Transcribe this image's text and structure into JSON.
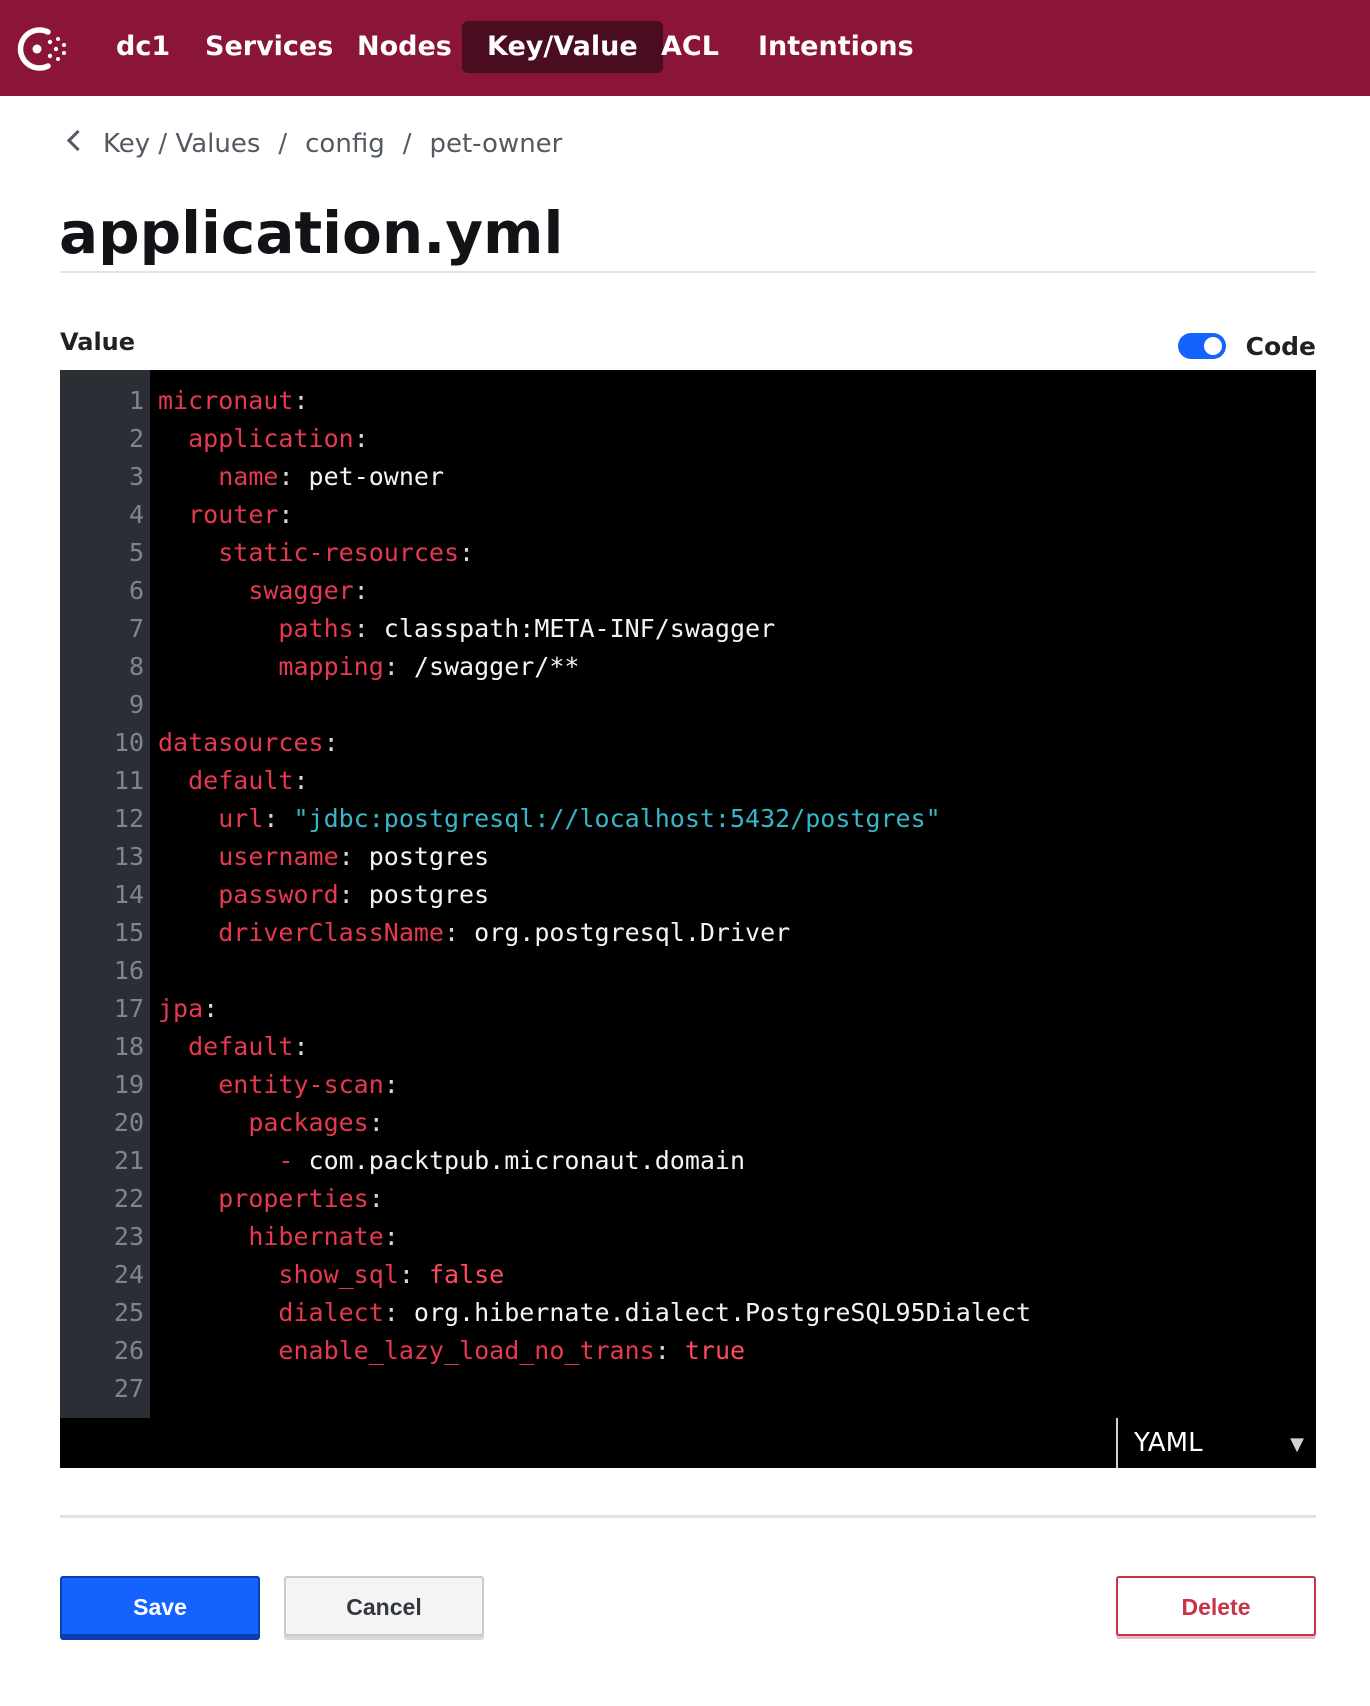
{
  "nav": {
    "items": [
      {
        "label": "dc1",
        "active": false
      },
      {
        "label": "Services",
        "active": false
      },
      {
        "label": "Nodes",
        "active": false
      },
      {
        "label": "Key/Value",
        "active": true
      },
      {
        "label": "ACL",
        "active": false
      },
      {
        "label": "Intentions",
        "active": false
      }
    ],
    "background": "#8a1538",
    "active_background": "#4a0d1f"
  },
  "breadcrumb": [
    "Key / Values",
    "config",
    "pet-owner"
  ],
  "page_title": "application.yml",
  "value_label": "Value",
  "code_toggle": {
    "label": "Code",
    "enabled": true
  },
  "editor": {
    "mode": "YAML",
    "lines": [
      {
        "n": "1",
        "tokens": [
          {
            "t": "micronaut",
            "c": "key"
          },
          {
            "t": ":",
            "c": "punct"
          }
        ]
      },
      {
        "n": "2",
        "tokens": [
          {
            "t": "  ",
            "c": "val"
          },
          {
            "t": "application",
            "c": "key"
          },
          {
            "t": ":",
            "c": "punct"
          }
        ]
      },
      {
        "n": "3",
        "tokens": [
          {
            "t": "    ",
            "c": "val"
          },
          {
            "t": "name",
            "c": "key"
          },
          {
            "t": ":",
            "c": "punct"
          },
          {
            "t": " pet-owner",
            "c": "val"
          }
        ]
      },
      {
        "n": "4",
        "tokens": [
          {
            "t": "  ",
            "c": "val"
          },
          {
            "t": "router",
            "c": "key"
          },
          {
            "t": ":",
            "c": "punct"
          }
        ]
      },
      {
        "n": "5",
        "tokens": [
          {
            "t": "    ",
            "c": "val"
          },
          {
            "t": "static-resources",
            "c": "key"
          },
          {
            "t": ":",
            "c": "punct"
          }
        ]
      },
      {
        "n": "6",
        "tokens": [
          {
            "t": "      ",
            "c": "val"
          },
          {
            "t": "swagger",
            "c": "key"
          },
          {
            "t": ":",
            "c": "punct"
          }
        ]
      },
      {
        "n": "7",
        "tokens": [
          {
            "t": "        ",
            "c": "val"
          },
          {
            "t": "paths",
            "c": "key"
          },
          {
            "t": ":",
            "c": "punct"
          },
          {
            "t": " classpath:META-INF/swagger",
            "c": "val"
          }
        ]
      },
      {
        "n": "8",
        "tokens": [
          {
            "t": "        ",
            "c": "val"
          },
          {
            "t": "mapping",
            "c": "key"
          },
          {
            "t": ":",
            "c": "punct"
          },
          {
            "t": " /swagger/**",
            "c": "val"
          }
        ]
      },
      {
        "n": "9",
        "tokens": []
      },
      {
        "n": "10",
        "tokens": [
          {
            "t": "datasources",
            "c": "key"
          },
          {
            "t": ":",
            "c": "punct"
          }
        ]
      },
      {
        "n": "11",
        "tokens": [
          {
            "t": "  ",
            "c": "val"
          },
          {
            "t": "default",
            "c": "key"
          },
          {
            "t": ":",
            "c": "punct"
          }
        ]
      },
      {
        "n": "12",
        "tokens": [
          {
            "t": "    ",
            "c": "val"
          },
          {
            "t": "url",
            "c": "key"
          },
          {
            "t": ":",
            "c": "punct"
          },
          {
            "t": " ",
            "c": "val"
          },
          {
            "t": "\"jdbc:postgresql://localhost:5432/postgres\"",
            "c": "str"
          }
        ]
      },
      {
        "n": "13",
        "tokens": [
          {
            "t": "    ",
            "c": "val"
          },
          {
            "t": "username",
            "c": "key"
          },
          {
            "t": ":",
            "c": "punct"
          },
          {
            "t": " postgres",
            "c": "val"
          }
        ]
      },
      {
        "n": "14",
        "tokens": [
          {
            "t": "    ",
            "c": "val"
          },
          {
            "t": "password",
            "c": "key"
          },
          {
            "t": ":",
            "c": "punct"
          },
          {
            "t": " postgres",
            "c": "val"
          }
        ]
      },
      {
        "n": "15",
        "tokens": [
          {
            "t": "    ",
            "c": "val"
          },
          {
            "t": "driverClassName",
            "c": "key"
          },
          {
            "t": ":",
            "c": "punct"
          },
          {
            "t": " org.postgresql.Driver",
            "c": "val"
          }
        ]
      },
      {
        "n": "16",
        "tokens": []
      },
      {
        "n": "17",
        "tokens": [
          {
            "t": "jpa",
            "c": "key"
          },
          {
            "t": ":",
            "c": "punct"
          }
        ]
      },
      {
        "n": "18",
        "tokens": [
          {
            "t": "  ",
            "c": "val"
          },
          {
            "t": "default",
            "c": "key"
          },
          {
            "t": ":",
            "c": "punct"
          }
        ]
      },
      {
        "n": "19",
        "tokens": [
          {
            "t": "    ",
            "c": "val"
          },
          {
            "t": "entity-scan",
            "c": "key"
          },
          {
            "t": ":",
            "c": "punct"
          }
        ]
      },
      {
        "n": "20",
        "tokens": [
          {
            "t": "      ",
            "c": "val"
          },
          {
            "t": "packages",
            "c": "key"
          },
          {
            "t": ":",
            "c": "punct"
          }
        ]
      },
      {
        "n": "21",
        "tokens": [
          {
            "t": "        ",
            "c": "val"
          },
          {
            "t": "-",
            "c": "key"
          },
          {
            "t": " com.packtpub.micronaut.domain",
            "c": "val"
          }
        ]
      },
      {
        "n": "22",
        "tokens": [
          {
            "t": "    ",
            "c": "val"
          },
          {
            "t": "properties",
            "c": "key"
          },
          {
            "t": ":",
            "c": "punct"
          }
        ]
      },
      {
        "n": "23",
        "tokens": [
          {
            "t": "      ",
            "c": "val"
          },
          {
            "t": "hibernate",
            "c": "key"
          },
          {
            "t": ":",
            "c": "punct"
          }
        ]
      },
      {
        "n": "24",
        "tokens": [
          {
            "t": "        ",
            "c": "val"
          },
          {
            "t": "show_sql",
            "c": "key"
          },
          {
            "t": ":",
            "c": "punct"
          },
          {
            "t": " ",
            "c": "val"
          },
          {
            "t": "false",
            "c": "bool"
          }
        ]
      },
      {
        "n": "25",
        "tokens": [
          {
            "t": "        ",
            "c": "val"
          },
          {
            "t": "dialect",
            "c": "key"
          },
          {
            "t": ":",
            "c": "punct"
          },
          {
            "t": " org.hibernate.dialect.PostgreSQL95Dialect",
            "c": "val"
          }
        ]
      },
      {
        "n": "26",
        "tokens": [
          {
            "t": "        ",
            "c": "val"
          },
          {
            "t": "enable_lazy_load_no_trans",
            "c": "key"
          },
          {
            "t": ":",
            "c": "punct"
          },
          {
            "t": " ",
            "c": "val"
          },
          {
            "t": "true",
            "c": "bool"
          }
        ]
      },
      {
        "n": "27",
        "tokens": []
      }
    ]
  },
  "actions": {
    "save_label": "Save",
    "cancel_label": "Cancel",
    "delete_label": "Delete"
  },
  "colors": {
    "primary": "#1563ff",
    "danger": "#c73445",
    "yaml_key": "#e5394f",
    "yaml_string": "#38b6c7",
    "yaml_value": "#f4f4f4"
  }
}
